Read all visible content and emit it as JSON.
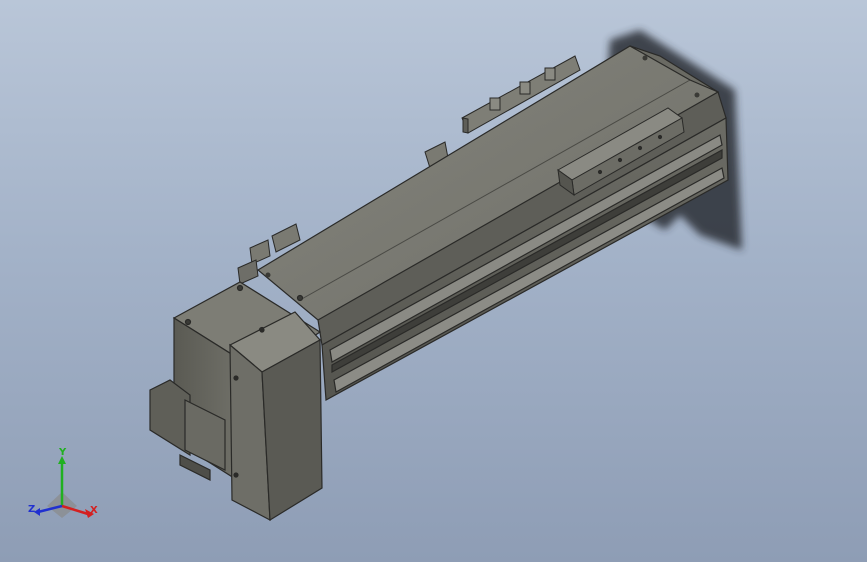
{
  "viewport": {
    "background_top": "#b9c6d8",
    "background_bottom": "#8e9db5"
  },
  "model": {
    "description_colors": {
      "body_top": "#7a7a72",
      "body_side": "#65655e",
      "body_dark": "#4a4a45",
      "edge": "#2a2a28",
      "rail": "#8a8a84"
    }
  },
  "triad": {
    "x_label": "X",
    "y_label": "Y",
    "z_label": "Z",
    "x_color": "#d42020",
    "y_color": "#20b020",
    "z_color": "#2030d0"
  }
}
